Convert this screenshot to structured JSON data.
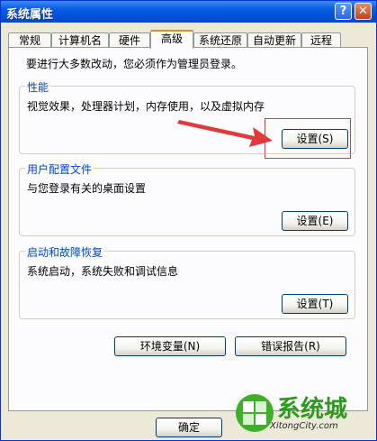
{
  "window": {
    "title": "系统属性",
    "help_label": "?",
    "close_label": "✕"
  },
  "tabs": [
    {
      "label": "常规"
    },
    {
      "label": "计算机名"
    },
    {
      "label": "硬件"
    },
    {
      "label": "高级"
    },
    {
      "label": "系统还原"
    },
    {
      "label": "自动更新"
    },
    {
      "label": "远程"
    }
  ],
  "active_tab": "高级",
  "intro": "要进行大多数改动，您必须作为管理员登录。",
  "performance": {
    "title": "性能",
    "description": "视觉效果，处理器计划，内存使用，以及虚拟内存",
    "button": "设置(S)"
  },
  "user_profiles": {
    "title": "用户配置文件",
    "description": "与您登录有关的桌面设置",
    "button": "设置(E)"
  },
  "startup": {
    "title": "启动和故障恢复",
    "description": "系统启动，系统失败和调试信息",
    "button": "设置(T)"
  },
  "env_button": "环境变量(N)",
  "error_button": "错误报告(R)",
  "ok_button": "确定",
  "watermark": {
    "brand": "系统城",
    "url": "XitongCity.com"
  },
  "colors": {
    "titlebar": "#0a5fe3",
    "group_title": "#0046d5",
    "annotation": "#e23a3a",
    "watermark": "#2c9a1c"
  },
  "icons": [
    "help-icon",
    "close-icon",
    "red-arrow-icon",
    "watermark-logo-icon"
  ]
}
